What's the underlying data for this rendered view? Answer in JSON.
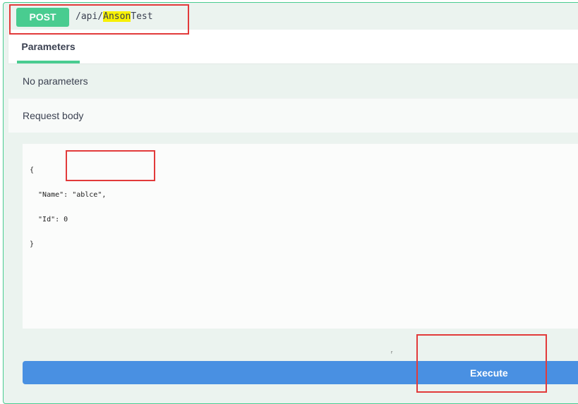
{
  "operation": {
    "method": "POST",
    "path_prefix": "/api/",
    "path_highlight": "Anson",
    "path_suffix": "Test"
  },
  "parameters": {
    "tab_label": "Parameters",
    "no_params_text": "No parameters"
  },
  "request_body": {
    "label": "Request body",
    "lines": [
      "{",
      "  \"Name\": \"ablce\",",
      "  \"Id\": 0",
      "}"
    ]
  },
  "misc": {
    "stray_mark": "ᵣ"
  },
  "actions": {
    "execute_label": "Execute"
  },
  "colors": {
    "post_green": "#49cc90",
    "execute_blue": "#4990e2",
    "highlight_yellow": "#f7f000",
    "annotation_red": "#e23a3a"
  }
}
